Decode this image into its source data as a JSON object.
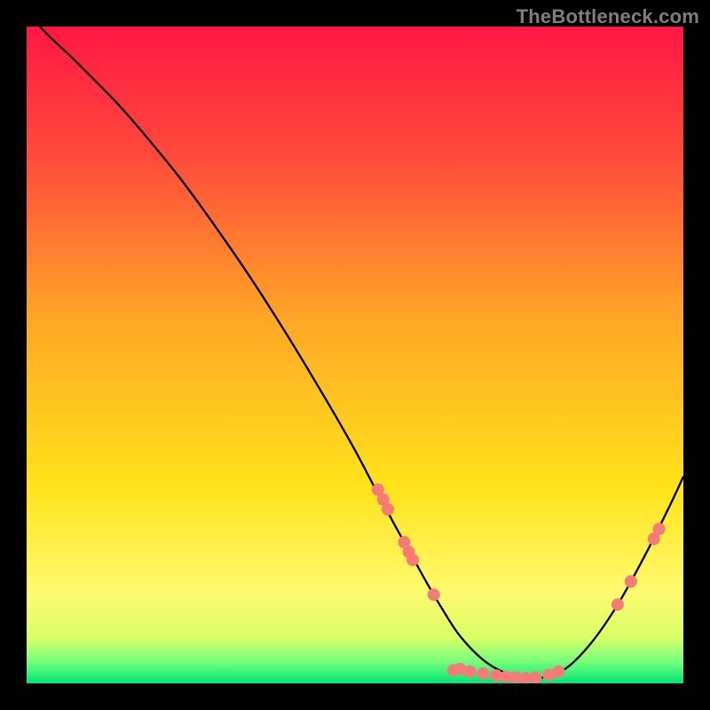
{
  "watermark": "TheBottleneck.com",
  "chart_data": {
    "type": "line",
    "title": "",
    "xlabel": "",
    "ylabel": "",
    "xlim": [
      0,
      100
    ],
    "ylim": [
      0,
      100
    ],
    "grid": false,
    "legend": false,
    "gradient_stops": [
      {
        "offset": 0.0,
        "color": "#ff1744"
      },
      {
        "offset": 0.2,
        "color": "#ff4b3a"
      },
      {
        "offset": 0.45,
        "color": "#ffa826"
      },
      {
        "offset": 0.7,
        "color": "#ffe21a"
      },
      {
        "offset": 0.86,
        "color": "#fff96e"
      },
      {
        "offset": 0.93,
        "color": "#d9ff66"
      },
      {
        "offset": 0.965,
        "color": "#7bff7b"
      },
      {
        "offset": 1.0,
        "color": "#00e676"
      }
    ],
    "series": [
      {
        "name": "bottleneck-curve",
        "color": "#000000",
        "x": [
          2,
          4,
          7,
          10,
          14,
          18,
          23,
          28,
          34,
          40,
          46,
          50,
          53,
          56,
          59,
          61,
          63,
          66,
          70,
          74,
          78,
          82,
          86,
          90,
          94,
          98,
          100
        ],
        "y": [
          100,
          98,
          95.2,
          92.2,
          88.1,
          83.5,
          77.4,
          70.6,
          61.9,
          52.5,
          42.5,
          35.5,
          29.8,
          24.2,
          18.8,
          15.2,
          11.8,
          7.2,
          3.2,
          1.2,
          0.8,
          2.2,
          6.2,
          12.0,
          19.2,
          27.2,
          31.5
        ]
      }
    ],
    "markers": {
      "color": "#f67b78",
      "radius": 7,
      "points": [
        {
          "x": 53.5,
          "y": 29.5
        },
        {
          "x": 54.3,
          "y": 28.0
        },
        {
          "x": 55.0,
          "y": 26.5
        },
        {
          "x": 57.5,
          "y": 21.5
        },
        {
          "x": 58.2,
          "y": 20.0
        },
        {
          "x": 58.8,
          "y": 18.8
        },
        {
          "x": 62.0,
          "y": 13.5
        },
        {
          "x": 65.0,
          "y": 2.0
        },
        {
          "x": 66.0,
          "y": 2.2
        },
        {
          "x": 67.5,
          "y": 1.8
        },
        {
          "x": 69.5,
          "y": 1.5
        },
        {
          "x": 71.5,
          "y": 1.2
        },
        {
          "x": 73.0,
          "y": 1.0
        },
        {
          "x": 74.5,
          "y": 0.9
        },
        {
          "x": 76.0,
          "y": 0.8
        },
        {
          "x": 77.5,
          "y": 0.9
        },
        {
          "x": 79.5,
          "y": 1.3
        },
        {
          "x": 81.0,
          "y": 1.8
        },
        {
          "x": 90.0,
          "y": 12.0
        },
        {
          "x": 92.0,
          "y": 15.5
        },
        {
          "x": 95.5,
          "y": 22.0
        },
        {
          "x": 96.3,
          "y": 23.5
        }
      ]
    }
  }
}
